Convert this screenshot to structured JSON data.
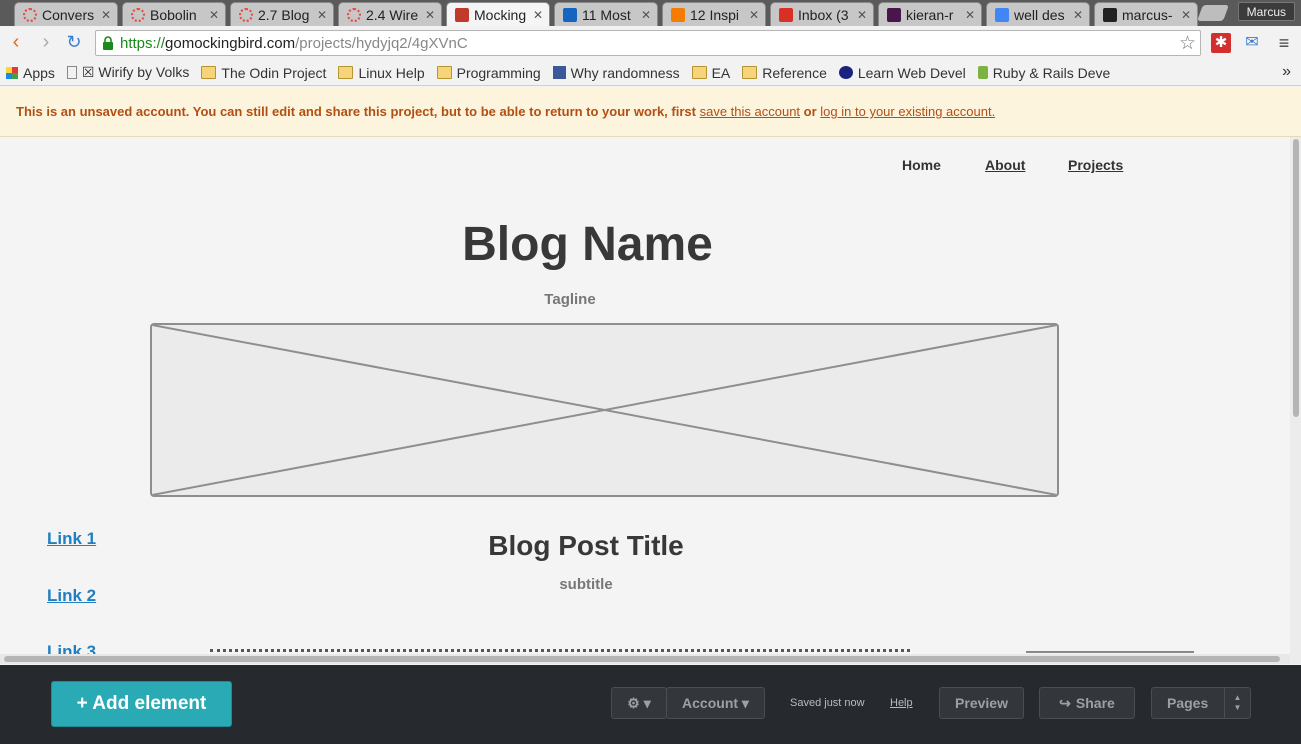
{
  "browser": {
    "tabs": [
      {
        "title": "Convers",
        "favicon": "loading-icon",
        "color": "#e04a3f"
      },
      {
        "title": "Bobolin",
        "favicon": "loading-icon",
        "color": "#e04a3f"
      },
      {
        "title": "2.7 Blog",
        "favicon": "loading-icon",
        "color": "#e04a3f"
      },
      {
        "title": "2.4 Wire",
        "favicon": "loading-icon",
        "color": "#e04a3f"
      },
      {
        "title": "Mocking",
        "favicon": "mockingbird-icon",
        "color": "#c0392b",
        "active": true
      },
      {
        "title": "11 Most",
        "favicon": "h-icon",
        "color": "#1565c0"
      },
      {
        "title": "12 Inspi",
        "favicon": "hubspot-icon",
        "color": "#f57c00"
      },
      {
        "title": "Inbox (3",
        "favicon": "gmail-icon",
        "color": "#d93025"
      },
      {
        "title": "kieran-r",
        "favicon": "slack-icon",
        "color": "#4a154b"
      },
      {
        "title": "well des",
        "favicon": "google-icon",
        "color": "#4285f4"
      },
      {
        "title": "marcus-",
        "favicon": "github-icon",
        "color": "#222222"
      }
    ],
    "profile": "Marcus",
    "url": {
      "scheme": "https://",
      "host": "gomockingbird.com",
      "path": "/projects/hydyjq2/4gXVnC"
    },
    "bookmarks": [
      {
        "label": "Apps",
        "icon": "apps-grid-icon"
      },
      {
        "label": "☒ Wirify by Volks",
        "icon": "page-icon"
      },
      {
        "label": "The Odin Project",
        "icon": "folder-icon"
      },
      {
        "label": "Linux Help",
        "icon": "folder-icon"
      },
      {
        "label": "Programming",
        "icon": "folder-icon"
      },
      {
        "label": "Why randomness",
        "icon": "facebook-icon"
      },
      {
        "label": "EA",
        "icon": "folder-icon"
      },
      {
        "label": "Reference",
        "icon": "folder-icon"
      },
      {
        "label": "Learn Web Devel",
        "icon": "owl-icon"
      },
      {
        "label": "Ruby & Rails Deve",
        "icon": "y-icon"
      }
    ],
    "bookmarks_more": "»"
  },
  "notice": {
    "text": "This is an unsaved account. You can still edit and share this project, but to be able to return to your work, first",
    "link1": "save this account",
    "or": "or",
    "link2": "log in to your existing account."
  },
  "mockup": {
    "nav": {
      "home": "Home",
      "about": "About",
      "projects": "Projects"
    },
    "blog_name": "Blog Name",
    "tagline": "Tagline",
    "side_links": [
      "Link 1",
      "Link 2",
      "Link 3"
    ],
    "post_title": "Blog Post Title",
    "subtitle": "subtitle"
  },
  "bottom_bar": {
    "add_element": "+ Add element",
    "settings_caret": "▾",
    "account": "Account ▾",
    "saved_status": "Saved just now",
    "help": "Help",
    "preview": "Preview",
    "share": "Share",
    "pages": "Pages"
  },
  "colors": {
    "accent": "#2aaab5",
    "notice_text": "#b34f12",
    "link": "#1f7fc2"
  }
}
